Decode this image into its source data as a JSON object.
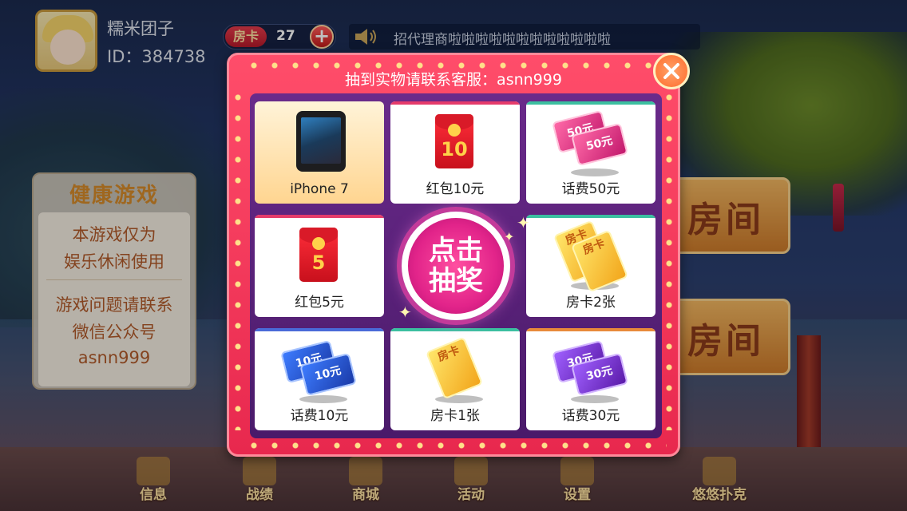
{
  "profile": {
    "name": "糯米团子",
    "id": "ID：384738"
  },
  "room_card": {
    "tag": "房卡",
    "count": "27",
    "plus": "+"
  },
  "notice": {
    "text": "招代理商啦啦啦啦啦啦啦啦啦啦啦啦"
  },
  "health": {
    "title": "健康游戏",
    "lines": [
      "本游戏仅为",
      "娱乐休闲使用",
      "游戏问题请联系",
      "微信公众号",
      "asnn999"
    ]
  },
  "rooms": [
    "房间",
    "房间"
  ],
  "nav": [
    "信息",
    "战绩",
    "商城",
    "活动",
    "设置",
    "悠悠扑克"
  ],
  "lottery": {
    "header": "抽到实物请联系客服：asnn999",
    "draw_line1": "点击",
    "draw_line2": "抽奖",
    "prizes": [
      {
        "label": "iPhone 7",
        "art": "phone-icon",
        "active": true
      },
      {
        "label": "红包10元",
        "art": "red-envelope-icon",
        "num": "10"
      },
      {
        "label": "话费50元",
        "art": "ticket-pink-icon",
        "num": "50元"
      },
      {
        "label": "红包5元",
        "art": "red-envelope-icon",
        "num": "5"
      },
      {
        "label": "房卡2张",
        "art": "room-card-icon",
        "num": "房卡"
      },
      {
        "label": "话费10元",
        "art": "ticket-blue-icon",
        "num": "10元"
      },
      {
        "label": "房卡1张",
        "art": "room-card-icon",
        "num": "房卡"
      },
      {
        "label": "话费30元",
        "art": "ticket-purple-icon",
        "num": "30元"
      }
    ]
  },
  "colors": {
    "modal": "#e8284e",
    "accent_gold": "#ffd24a",
    "draw_button": "#e2248a"
  }
}
